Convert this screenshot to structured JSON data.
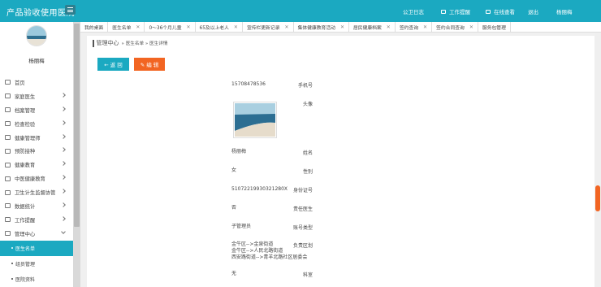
{
  "header": {
    "brand": "产品验收使用医院",
    "nav": [
      {
        "label": "公卫日志",
        "icon": "none"
      },
      {
        "label": "工作提醒",
        "icon": "doc-icon"
      },
      {
        "label": "在线查看",
        "icon": "monitor-icon"
      },
      {
        "label": "退出",
        "icon": "none"
      },
      {
        "label": "杨丽梅",
        "icon": "none"
      }
    ]
  },
  "sidebar": {
    "username": "杨丽梅",
    "items": [
      {
        "label": "首页",
        "icon": "home-icon"
      },
      {
        "label": "家庭医生",
        "icon": "doctor-icon"
      },
      {
        "label": "档案管理",
        "icon": "archive-icon"
      },
      {
        "label": "检查检验",
        "icon": "check-icon"
      },
      {
        "label": "健康管理师",
        "icon": "health-icon"
      },
      {
        "label": "预防接种",
        "icon": "syringe-icon"
      },
      {
        "label": "健康教育",
        "icon": "education-icon"
      },
      {
        "label": "中医健康教育",
        "icon": "tcm-icon"
      },
      {
        "label": "卫生计生监督协管",
        "icon": "supervise-icon"
      },
      {
        "label": "数据统计",
        "icon": "stats-icon"
      },
      {
        "label": "工作提醒",
        "icon": "reminder-icon"
      },
      {
        "label": "管理中心",
        "icon": "grid-icon"
      }
    ],
    "sub_items": [
      {
        "label": "医生名单",
        "active": true
      },
      {
        "label": "组员管理",
        "active": false
      },
      {
        "label": "医院资料",
        "active": false
      }
    ]
  },
  "tabs": [
    "我的桌面",
    "医生名单",
    "0～36个月儿童",
    "65及以上老人",
    "宣传栏更新记录",
    "集体健康教育活动",
    "居民健康档案",
    "签约查询",
    "签约合同查询",
    "服务包管理"
  ],
  "breadcrumb": {
    "root": "管理中心",
    "parts": "» 医生名单 » 医生详情"
  },
  "buttons": {
    "back": "← 返 回",
    "edit": "✎ 编 辑"
  },
  "details": {
    "phone": {
      "label": "手机号",
      "value": "15708478536"
    },
    "avatar": {
      "label": "头像"
    },
    "name": {
      "label": "姓名",
      "value": "杨丽梅"
    },
    "gender": {
      "label": "性别",
      "value": "女"
    },
    "id_card": {
      "label": "身份证号",
      "value": "51072219930321280X"
    },
    "is_leader": {
      "label": "责任医生",
      "value": "否"
    },
    "account_type": {
      "label": "账号类型",
      "value": "子管理员"
    },
    "area": {
      "label": "负责区划",
      "lines": [
        "金牛区-->金泉街道",
        "金牛区-->人民北路街道",
        "西安路街道-->青羊北路社区居委会"
      ]
    },
    "dept": {
      "label": "科室",
      "value": "无"
    }
  },
  "colors": {
    "primary": "#1ba9c1",
    "accent": "#f26522"
  }
}
